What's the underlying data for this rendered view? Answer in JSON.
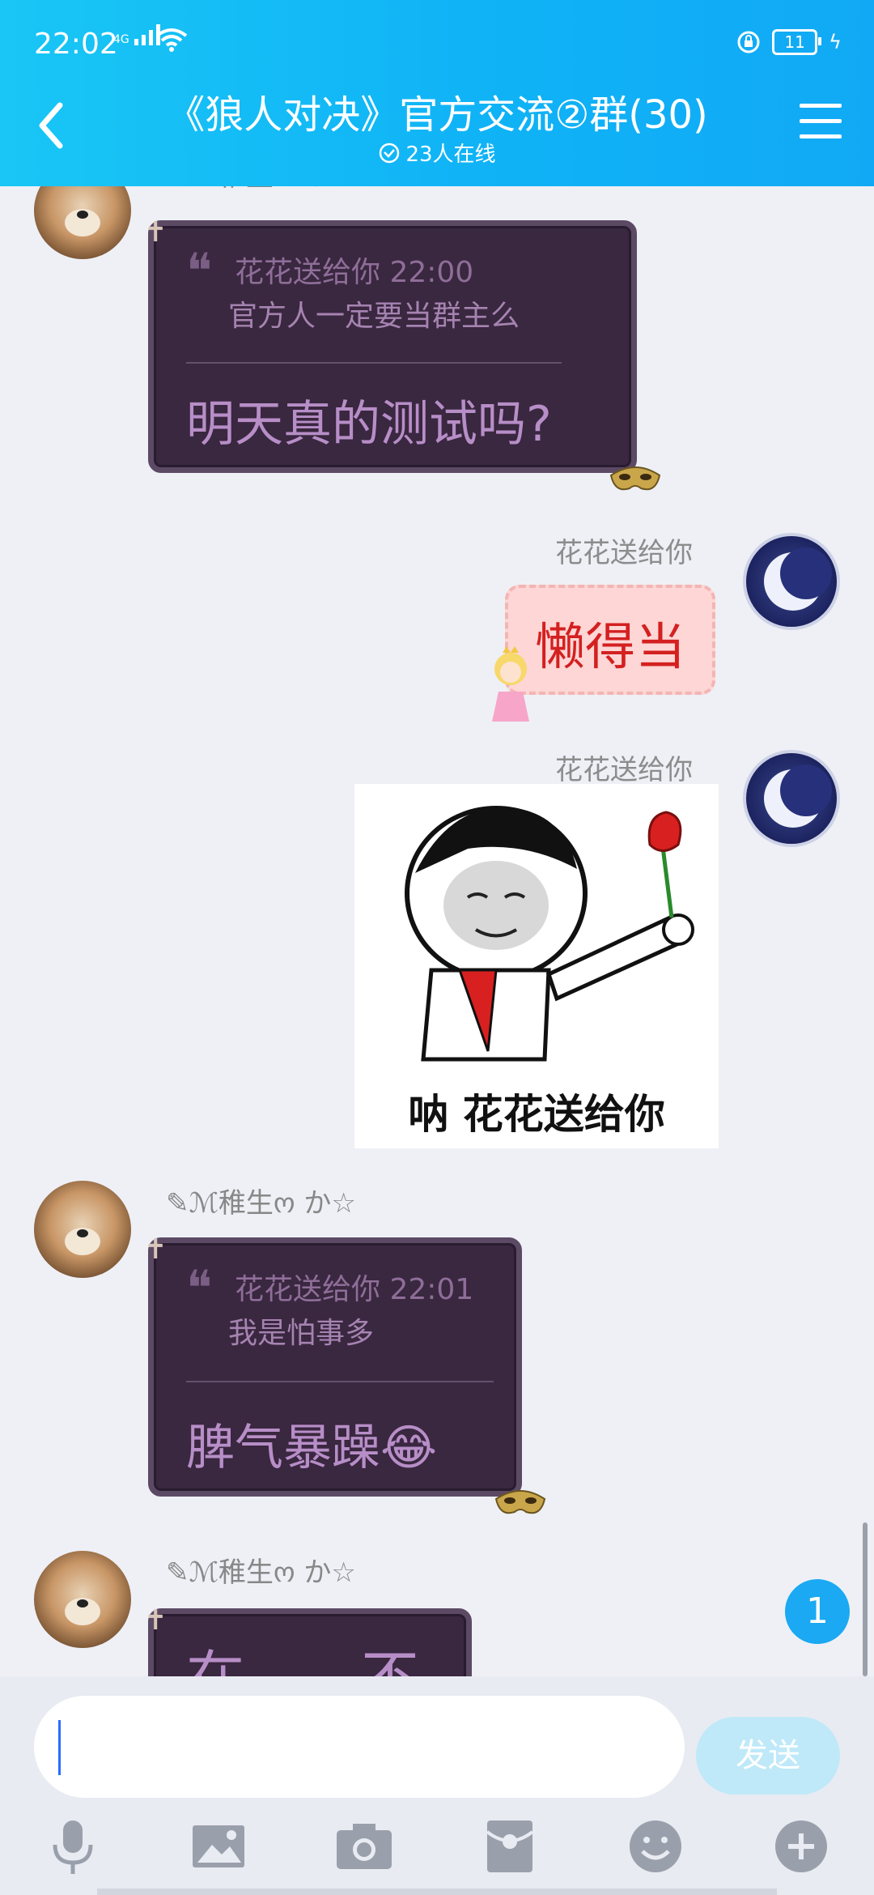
{
  "status_bar": {
    "time": "22:02",
    "network": "4G",
    "battery": "11"
  },
  "header": {
    "title": "《狼人对决》官方交流②群(30)",
    "online": "23人在线"
  },
  "messages": [
    {
      "sender": "✎ℳ稚生ო か☆",
      "quote": {
        "author_time": "花花送给你 22:00",
        "text": "官方人一定要当群主么"
      },
      "text": "明天真的测试吗?"
    },
    {
      "sender": "花花送给你",
      "text": "懒得当"
    },
    {
      "sender": "花花送给你",
      "sticker_caption": "呐 花花送给你"
    },
    {
      "sender": "✎ℳ稚生ო か☆",
      "quote": {
        "author_time": "花花送给你 22:01",
        "text": "我是怕事多"
      },
      "text": "脾气暴躁😂"
    },
    {
      "sender": "✎ℳ稚生ო か☆",
      "text": "在……不截"
    }
  ],
  "unread_count": "1",
  "input": {
    "value": "",
    "send_label": "发送"
  },
  "toolbar": [
    "microphone-icon",
    "image-icon",
    "camera-icon",
    "red-packet-icon",
    "emoji-icon",
    "plus-icon"
  ]
}
